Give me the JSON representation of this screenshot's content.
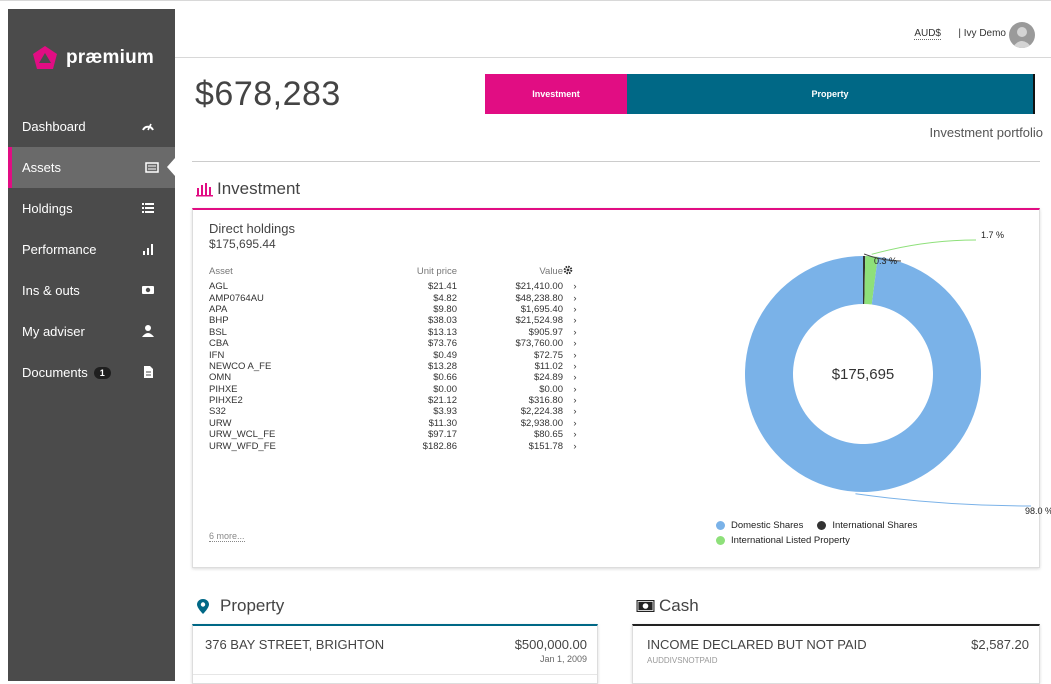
{
  "brand": {
    "name": "præmium",
    "accent": "#e10d83",
    "primary": "#006886",
    "sidebar_bg": "#4b4b4b"
  },
  "sidebar": {
    "items": [
      {
        "label": "Dashboard",
        "icon": "gauge-icon"
      },
      {
        "label": "Assets",
        "icon": "list-box-icon",
        "active": true
      },
      {
        "label": "Holdings",
        "icon": "list-icon"
      },
      {
        "label": "Performance",
        "icon": "bar-chart-icon"
      },
      {
        "label": "Ins & outs",
        "icon": "money-icon"
      },
      {
        "label": "My adviser",
        "icon": "person-icon"
      },
      {
        "label": "Documents",
        "icon": "document-icon",
        "badge": "1"
      }
    ]
  },
  "topbar": {
    "currency": "AUD$",
    "user": "| Ivy Demo"
  },
  "summary": {
    "total": "$678,283",
    "tab_investment": "Investment",
    "tab_property": "Property",
    "subtitle": "Investment portfolio"
  },
  "investment": {
    "title": "Investment",
    "direct_holdings_label": "Direct holdings",
    "direct_holdings_total": "$175,695.44",
    "columns": {
      "asset": "Asset",
      "unit_price": "Unit price",
      "value": "Value"
    },
    "rows": [
      {
        "asset": "AGL",
        "unit_price": "$21.41",
        "value": "$21,410.00"
      },
      {
        "asset": "AMP0764AU",
        "unit_price": "$4.82",
        "value": "$48,238.80"
      },
      {
        "asset": "APA",
        "unit_price": "$9.80",
        "value": "$1,695.40"
      },
      {
        "asset": "BHP",
        "unit_price": "$38.03",
        "value": "$21,524.98"
      },
      {
        "asset": "BSL",
        "unit_price": "$13.13",
        "value": "$905.97"
      },
      {
        "asset": "CBA",
        "unit_price": "$73.76",
        "value": "$73,760.00"
      },
      {
        "asset": "IFN",
        "unit_price": "$0.49",
        "value": "$72.75"
      },
      {
        "asset": "NEWCO A_FE",
        "unit_price": "$13.28",
        "value": "$11.02"
      },
      {
        "asset": "OMN",
        "unit_price": "$0.66",
        "value": "$24.89"
      },
      {
        "asset": "PIHXE",
        "unit_price": "$0.00",
        "value": "$0.00"
      },
      {
        "asset": "PIHXE2",
        "unit_price": "$21.12",
        "value": "$316.80"
      },
      {
        "asset": "S32",
        "unit_price": "$3.93",
        "value": "$2,224.38"
      },
      {
        "asset": "URW",
        "unit_price": "$11.30",
        "value": "$2,938.00"
      },
      {
        "asset": "URW_WCL_FE",
        "unit_price": "$97.17",
        "value": "$80.65"
      },
      {
        "asset": "URW_WFD_FE",
        "unit_price": "$182.86",
        "value": "$151.78"
      }
    ],
    "more_link": "6 more...",
    "arrow": "›"
  },
  "chart_data": {
    "type": "pie",
    "center_label": "$175,695",
    "categories": [
      "Domestic Shares",
      "International Shares",
      "International Listed Property"
    ],
    "values": [
      98.0,
      0.3,
      1.7
    ],
    "value_labels": [
      "98.0 %",
      "0.3 %",
      "1.7 %"
    ],
    "colors": [
      "#7ab2e8",
      "#333333",
      "#8ee07a"
    ],
    "legend_position": "bottom"
  },
  "property": {
    "title": "Property",
    "items": [
      {
        "address": "376 BAY STREET, BRIGHTON",
        "value": "$500,000.00",
        "date": "Jan 1, 2009"
      }
    ]
  },
  "cash": {
    "title": "Cash",
    "items": [
      {
        "name": "INCOME DECLARED BUT NOT PAID",
        "code": "AUDDIVSNOTPAID",
        "value": "$2,587.20"
      }
    ]
  }
}
